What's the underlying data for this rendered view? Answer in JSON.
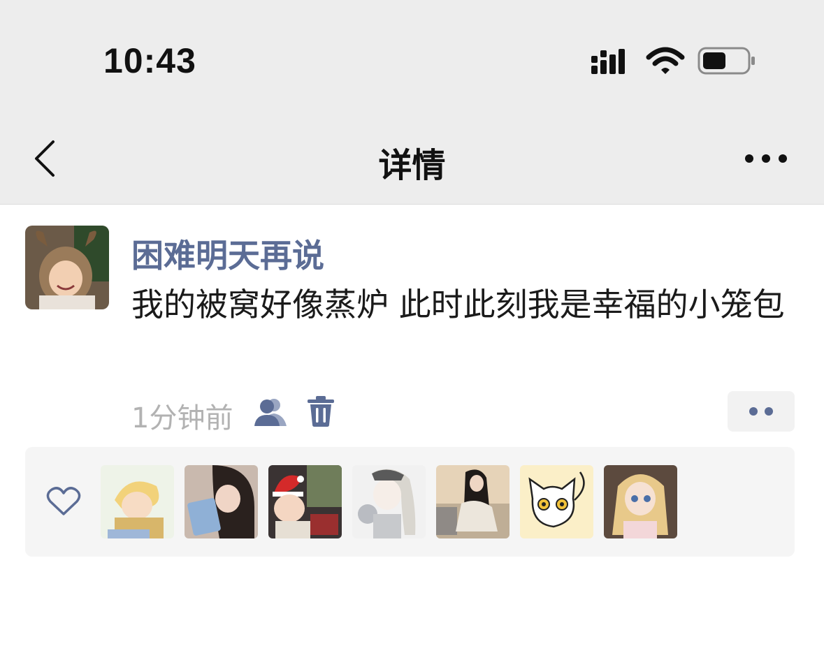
{
  "status_bar": {
    "time": "10:43",
    "icons": [
      "signal-icon",
      "wifi-icon",
      "battery-icon"
    ]
  },
  "nav": {
    "title": "详情",
    "back_icon": "chevron-left-icon",
    "more_icon": "ellipsis-icon"
  },
  "post": {
    "username": "困难明天再说",
    "text": "我的被窝好像蒸炉 此时此刻我是幸福的小笼包",
    "timestamp": "1分钟前",
    "visibility_icon": "users-icon",
    "delete_icon": "trash-icon",
    "action_icon": "two-dots-icon"
  },
  "likes": {
    "heart_icon": "heart-outline-icon",
    "avatars": [
      "liker-avatar-1",
      "liker-avatar-2",
      "liker-avatar-3",
      "liker-avatar-4",
      "liker-avatar-5",
      "liker-avatar-6",
      "liker-avatar-7"
    ]
  },
  "colors": {
    "background": "#ffffff",
    "bar_background": "#ededed",
    "username": "#5b6c95",
    "timestamp": "#b2b2b2",
    "likes_panel": "#f5f5f5"
  }
}
